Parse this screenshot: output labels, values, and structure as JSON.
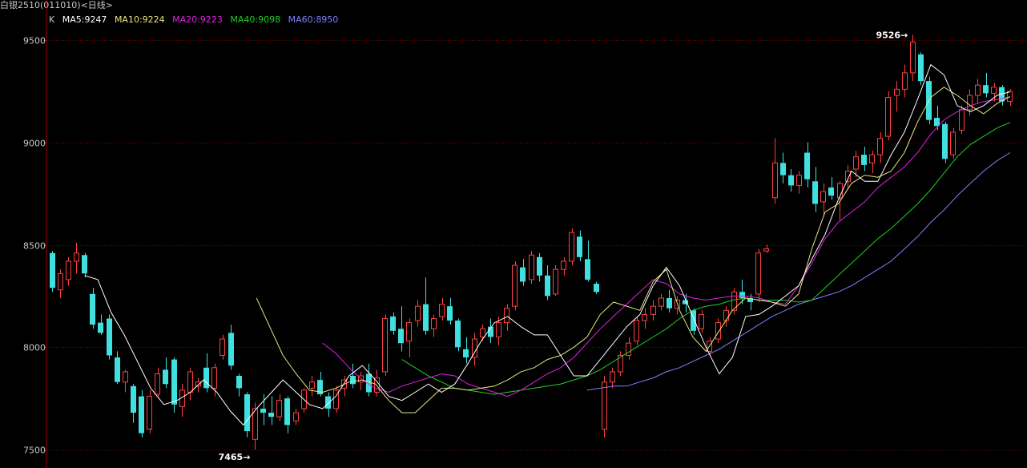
{
  "title": "白银2510(011010)<日线>",
  "legend": {
    "k": "K",
    "ma5": "MA5:9247",
    "ma10": "MA10:9224",
    "ma20": "MA20:9223",
    "ma40": "MA40:9098",
    "ma60": "MA60:8950"
  },
  "colors": {
    "up": "#ff4040",
    "down": "#40e0e0",
    "ma5": "#ffffff",
    "ma10": "#e6e680",
    "ma20": "#e020e0",
    "ma40": "#20d020",
    "ma60": "#7f7fff",
    "axis": "#a00000",
    "grid": "#800000",
    "label": "#c8c8c8"
  },
  "chart_data": {
    "type": "candlestick",
    "title": "白银2510(011010)<日线>",
    "y_ticks": [
      7500,
      8000,
      8500,
      9000,
      9500
    ],
    "ylim": [
      7395,
      9610
    ],
    "grid": true,
    "annotations": [
      {
        "text": "9526",
        "value": 9526
      },
      {
        "text": "7465",
        "value": 7465
      }
    ],
    "candles": [
      [
        8460,
        8470,
        8270,
        8290
      ],
      [
        8280,
        8380,
        8240,
        8360
      ],
      [
        8330,
        8440,
        8300,
        8420
      ],
      [
        8420,
        8510,
        8360,
        8460
      ],
      [
        8450,
        8460,
        8340,
        8360
      ],
      [
        8260,
        8290,
        8090,
        8110
      ],
      [
        8120,
        8160,
        8060,
        8070
      ],
      [
        8140,
        8160,
        7940,
        7960
      ],
      [
        7950,
        7980,
        7820,
        7830
      ],
      [
        7830,
        7890,
        7780,
        7880
      ],
      [
        7810,
        7820,
        7630,
        7680
      ],
      [
        7760,
        7790,
        7560,
        7580
      ],
      [
        7600,
        7790,
        7580,
        7760
      ],
      [
        7770,
        7900,
        7750,
        7870
      ],
      [
        7890,
        7950,
        7800,
        7820
      ],
      [
        7940,
        7950,
        7680,
        7720
      ],
      [
        7710,
        7820,
        7660,
        7790
      ],
      [
        7780,
        7900,
        7740,
        7880
      ],
      [
        7810,
        7850,
        7780,
        7830
      ],
      [
        7900,
        7970,
        7780,
        7800
      ],
      [
        7800,
        7920,
        7760,
        7900
      ],
      [
        7960,
        8060,
        7940,
        8040
      ],
      [
        8070,
        8110,
        7890,
        7910
      ],
      [
        7860,
        7870,
        7760,
        7800
      ],
      [
        7770,
        7780,
        7560,
        7590
      ],
      [
        7550,
        7730,
        7500,
        7700
      ],
      [
        7700,
        7770,
        7620,
        7680
      ],
      [
        7680,
        7760,
        7620,
        7660
      ],
      [
        7660,
        7770,
        7640,
        7740
      ],
      [
        7750,
        7760,
        7580,
        7620
      ],
      [
        7640,
        7700,
        7620,
        7680
      ],
      [
        7700,
        7800,
        7680,
        7790
      ],
      [
        7800,
        7860,
        7760,
        7830
      ],
      [
        7840,
        7880,
        7760,
        7770
      ],
      [
        7760,
        7780,
        7660,
        7700
      ],
      [
        7700,
        7810,
        7680,
        7790
      ],
      [
        7800,
        7860,
        7760,
        7840
      ],
      [
        7860,
        7920,
        7800,
        7820
      ],
      [
        7830,
        7880,
        7790,
        7860
      ],
      [
        7870,
        7920,
        7760,
        7780
      ],
      [
        7780,
        7890,
        7760,
        7850
      ],
      [
        7880,
        8160,
        7860,
        8140
      ],
      [
        8150,
        8170,
        8060,
        8080
      ],
      [
        8090,
        8200,
        7980,
        8020
      ],
      [
        8030,
        8140,
        7950,
        8120
      ],
      [
        8130,
        8230,
        8100,
        8200
      ],
      [
        8210,
        8340,
        8060,
        8080
      ],
      [
        8090,
        8160,
        8050,
        8140
      ],
      [
        8150,
        8240,
        8130,
        8210
      ],
      [
        8200,
        8240,
        8110,
        8130
      ],
      [
        8130,
        8140,
        7980,
        8000
      ],
      [
        7990,
        8050,
        7920,
        7950
      ],
      [
        7950,
        8070,
        7910,
        8040
      ],
      [
        8050,
        8110,
        8030,
        8090
      ],
      [
        8100,
        8140,
        8020,
        8050
      ],
      [
        8050,
        8150,
        8010,
        8120
      ],
      [
        8120,
        8210,
        8080,
        8190
      ],
      [
        8200,
        8420,
        8180,
        8400
      ],
      [
        8390,
        8430,
        8300,
        8320
      ],
      [
        8330,
        8470,
        8310,
        8450
      ],
      [
        8440,
        8460,
        8320,
        8350
      ],
      [
        8350,
        8400,
        8230,
        8250
      ],
      [
        8260,
        8400,
        8250,
        8380
      ],
      [
        8380,
        8440,
        8350,
        8420
      ],
      [
        8420,
        8580,
        8400,
        8560
      ],
      [
        8540,
        8570,
        8420,
        8440
      ],
      [
        8430,
        8520,
        8320,
        8330
      ],
      [
        8310,
        8320,
        8260,
        8270
      ],
      [
        7600,
        7860,
        7560,
        7830
      ],
      [
        7830,
        7900,
        7800,
        7880
      ],
      [
        7880,
        7980,
        7860,
        7960
      ],
      [
        7960,
        8050,
        7940,
        8020
      ],
      [
        8030,
        8150,
        8010,
        8130
      ],
      [
        8130,
        8190,
        8090,
        8160
      ],
      [
        8160,
        8230,
        8130,
        8200
      ],
      [
        8200,
        8260,
        8180,
        8240
      ],
      [
        8240,
        8280,
        8170,
        8190
      ],
      [
        8190,
        8250,
        8160,
        8230
      ],
      [
        8230,
        8260,
        8170,
        8210
      ],
      [
        8180,
        8190,
        8060,
        8080
      ],
      [
        8090,
        8180,
        8070,
        8160
      ],
      [
        7980,
        8050,
        7960,
        8030
      ],
      [
        8040,
        8140,
        8020,
        8120
      ],
      [
        8130,
        8200,
        8100,
        8180
      ],
      [
        8180,
        8290,
        8160,
        8270
      ],
      [
        8270,
        8330,
        8210,
        8240
      ],
      [
        8240,
        8260,
        8180,
        8220
      ],
      [
        8260,
        8480,
        8220,
        8460
      ],
      [
        8470,
        8500,
        8460,
        8480
      ],
      [
        8730,
        9020,
        8700,
        8900
      ],
      [
        8900,
        8950,
        8800,
        8840
      ],
      [
        8840,
        8870,
        8760,
        8790
      ],
      [
        8790,
        8860,
        8750,
        8840
      ],
      [
        8950,
        9000,
        8780,
        8820
      ],
      [
        8810,
        8880,
        8660,
        8700
      ],
      [
        8710,
        8800,
        8640,
        8760
      ],
      [
        8780,
        8830,
        8720,
        8740
      ],
      [
        8730,
        8810,
        8620,
        8800
      ],
      [
        8810,
        8890,
        8770,
        8860
      ],
      [
        8870,
        8960,
        8830,
        8930
      ],
      [
        8940,
        8980,
        8860,
        8890
      ],
      [
        8900,
        8960,
        8850,
        8940
      ],
      [
        8940,
        9050,
        8900,
        9020
      ],
      [
        9030,
        9250,
        9010,
        9220
      ],
      [
        9230,
        9300,
        9150,
        9260
      ],
      [
        9260,
        9380,
        9220,
        9340
      ],
      [
        9340,
        9526,
        9300,
        9490
      ],
      [
        9430,
        9440,
        9280,
        9300
      ],
      [
        9300,
        9320,
        9090,
        9110
      ],
      [
        9120,
        9180,
        9060,
        9080
      ],
      [
        9090,
        9100,
        8900,
        8920
      ],
      [
        8940,
        9070,
        8920,
        9050
      ],
      [
        9060,
        9180,
        9040,
        9160
      ],
      [
        9160,
        9260,
        9130,
        9230
      ],
      [
        9230,
        9310,
        9190,
        9280
      ],
      [
        9280,
        9340,
        9220,
        9240
      ],
      [
        9240,
        9290,
        9200,
        9270
      ],
      [
        9270,
        9280,
        9180,
        9200
      ],
      [
        9200,
        9260,
        9180,
        9250
      ]
    ],
    "ma5": [
      8350,
      8330,
      8170,
      8060,
      7930,
      7800,
      7720,
      7740,
      7780,
      7840,
      7780,
      7690,
      7620,
      7700,
      7770,
      7840,
      7780,
      7720,
      7700,
      7760,
      7860,
      7910,
      7840,
      7760,
      7740,
      7780,
      7820,
      7780,
      7820,
      7920,
      8030,
      8120,
      8150,
      8100,
      8060,
      8060,
      7960,
      7860,
      7860,
      7940,
      8020,
      8100,
      8160,
      8300,
      8390,
      8300,
      8150,
      8000,
      7870,
      7950,
      8150,
      8160,
      8200,
      8250,
      8300,
      8430,
      8550,
      8720,
      8860,
      8810,
      8810,
      8940,
      9050,
      9210,
      9380,
      9330,
      9180,
      9150,
      9180,
      9230,
      9247
    ],
    "ma10": [
      8240,
      8100,
      7960,
      7870,
      7790,
      7780,
      7800,
      7830,
      7840,
      7820,
      7740,
      7680,
      7680,
      7740,
      7800,
      7800,
      7790,
      7800,
      7810,
      7840,
      7880,
      7900,
      7940,
      7960,
      8000,
      8050,
      8160,
      8220,
      8200,
      8180,
      8320,
      8380,
      8180,
      8050,
      7980,
      8080,
      8180,
      8240,
      8230,
      8220,
      8200,
      8260,
      8480,
      8660,
      8700,
      8800,
      8840,
      8830,
      8860,
      8950,
      9100,
      9220,
      9270,
      9230,
      9180,
      9140,
      9190,
      9224
    ],
    "ma20": [
      8020,
      7970,
      7900,
      7840,
      7800,
      7780,
      7810,
      7830,
      7850,
      7870,
      7860,
      7820,
      7800,
      7780,
      7760,
      7790,
      7830,
      7870,
      7900,
      7950,
      8020,
      8090,
      8150,
      8210,
      8270,
      8330,
      8310,
      8260,
      8240,
      8230,
      8240,
      8250,
      8250,
      8240,
      8220,
      8210,
      8300,
      8410,
      8530,
      8610,
      8660,
      8710,
      8780,
      8830,
      8880,
      8950,
      9040,
      9110,
      9150,
      9180,
      9200,
      9210,
      9223
    ],
    "ma40": [
      7940,
      7900,
      7860,
      7830,
      7800,
      7790,
      7780,
      7770,
      7780,
      7790,
      7800,
      7810,
      7820,
      7840,
      7860,
      7890,
      7930,
      7970,
      8010,
      8050,
      8090,
      8140,
      8180,
      8200,
      8210,
      8230,
      8240,
      8230,
      8230,
      8230,
      8220,
      8230,
      8290,
      8350,
      8410,
      8470,
      8530,
      8580,
      8640,
      8700,
      8770,
      8850,
      8930,
      8990,
      9030,
      9070,
      9098
    ],
    "ma60": [
      7790,
      7800,
      7810,
      7810,
      7830,
      7850,
      7880,
      7900,
      7930,
      7960,
      7990,
      8030,
      8070,
      8110,
      8150,
      8180,
      8210,
      8230,
      8250,
      8270,
      8300,
      8340,
      8380,
      8420,
      8480,
      8540,
      8610,
      8670,
      8740,
      8800,
      8860,
      8910,
      8950
    ]
  }
}
